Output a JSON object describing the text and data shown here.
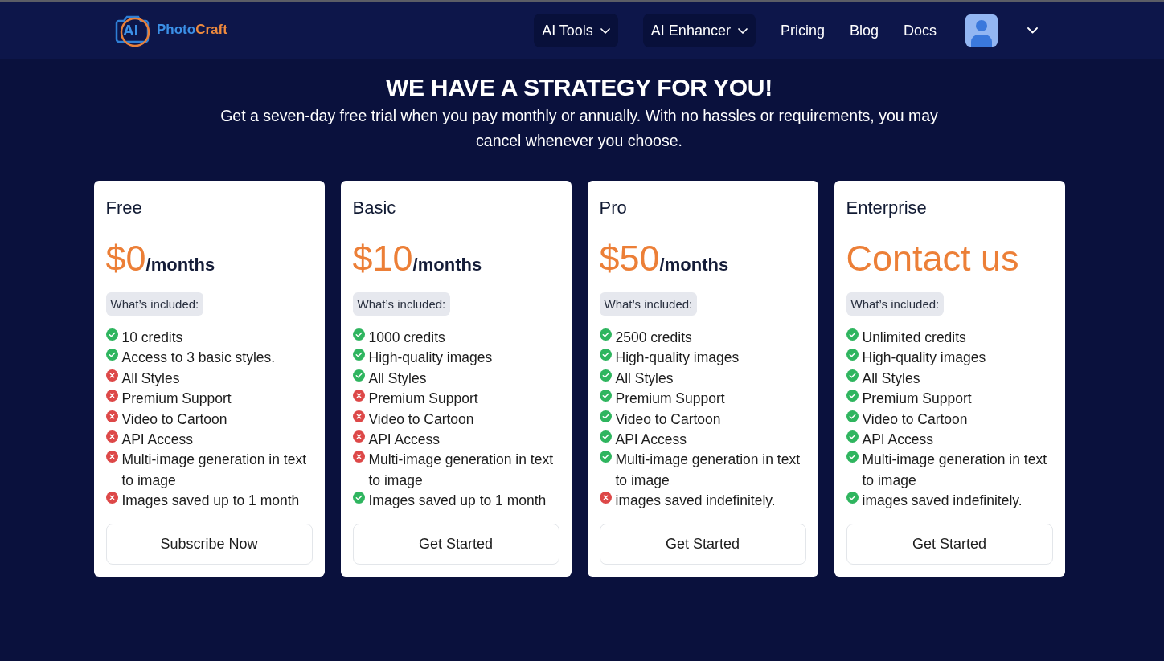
{
  "header": {
    "logo": {
      "mark": "AI",
      "words": [
        "Photo",
        "Craft"
      ]
    },
    "nav": [
      {
        "kind": "dropdown",
        "label": "AI Tools"
      },
      {
        "kind": "dropdown",
        "label": "AI Enhancer"
      },
      {
        "kind": "link",
        "label": "Pricing"
      },
      {
        "kind": "link",
        "label": "Blog"
      },
      {
        "kind": "link",
        "label": "Docs"
      }
    ]
  },
  "hero": {
    "title": "WE HAVE A STRATEGY FOR YOU!",
    "subtitle": "Get a seven-day free trial when you pay monthly or annually. With no hassles or requirements, you may cancel whenever you choose."
  },
  "plans": [
    {
      "name": "Free",
      "price": "$0",
      "period": "/months",
      "included_label": "What’s included:",
      "features": [
        {
          "text": "10 credits",
          "included": true
        },
        {
          "text": "Access to 3 basic styles.",
          "included": true
        },
        {
          "text": "All Styles",
          "included": false
        },
        {
          "text": "Premium Support",
          "included": false
        },
        {
          "text": "Video to Cartoon",
          "included": false
        },
        {
          "text": "API Access",
          "included": false
        },
        {
          "text": "Multi-image generation in text to image",
          "included": false
        },
        {
          "text": "Images saved up to 1 month",
          "included": false
        }
      ],
      "button": "Subscribe Now"
    },
    {
      "name": "Basic",
      "price": "$10",
      "period": "/months",
      "included_label": "What’s included:",
      "features": [
        {
          "text": "1000 credits",
          "included": true
        },
        {
          "text": "High-quality images",
          "included": true
        },
        {
          "text": "All Styles",
          "included": true
        },
        {
          "text": "Premium Support",
          "included": false
        },
        {
          "text": "Video to Cartoon",
          "included": false
        },
        {
          "text": "API Access",
          "included": false
        },
        {
          "text": "Multi-image generation in text to image",
          "included": false
        },
        {
          "text": "Images saved up to 1 month",
          "included": true
        }
      ],
      "button": "Get Started"
    },
    {
      "name": "Pro",
      "price": "$50",
      "period": "/months",
      "included_label": "What’s included:",
      "features": [
        {
          "text": "2500 credits",
          "included": true
        },
        {
          "text": "High-quality images",
          "included": true
        },
        {
          "text": "All Styles",
          "included": true
        },
        {
          "text": "Premium Support",
          "included": true
        },
        {
          "text": "Video to Cartoon",
          "included": true
        },
        {
          "text": "API Access",
          "included": true
        },
        {
          "text": "Multi-image generation in text to image",
          "included": true
        },
        {
          "text": "images saved indefinitely.",
          "included": false
        }
      ],
      "button": "Get Started"
    },
    {
      "name": "Enterprise",
      "price": "Contact us",
      "included_label": "What’s included:",
      "features": [
        {
          "text": "Unlimited credits",
          "included": true
        },
        {
          "text": "High-quality images",
          "included": true
        },
        {
          "text": "All Styles",
          "included": true
        },
        {
          "text": "Premium Support",
          "included": true
        },
        {
          "text": "Video to Cartoon",
          "included": true
        },
        {
          "text": "API Access",
          "included": true
        },
        {
          "text": "Multi-image generation in text to image",
          "included": true
        },
        {
          "text": "images saved indefinitely.",
          "included": true
        }
      ],
      "button": "Get Started"
    }
  ]
}
